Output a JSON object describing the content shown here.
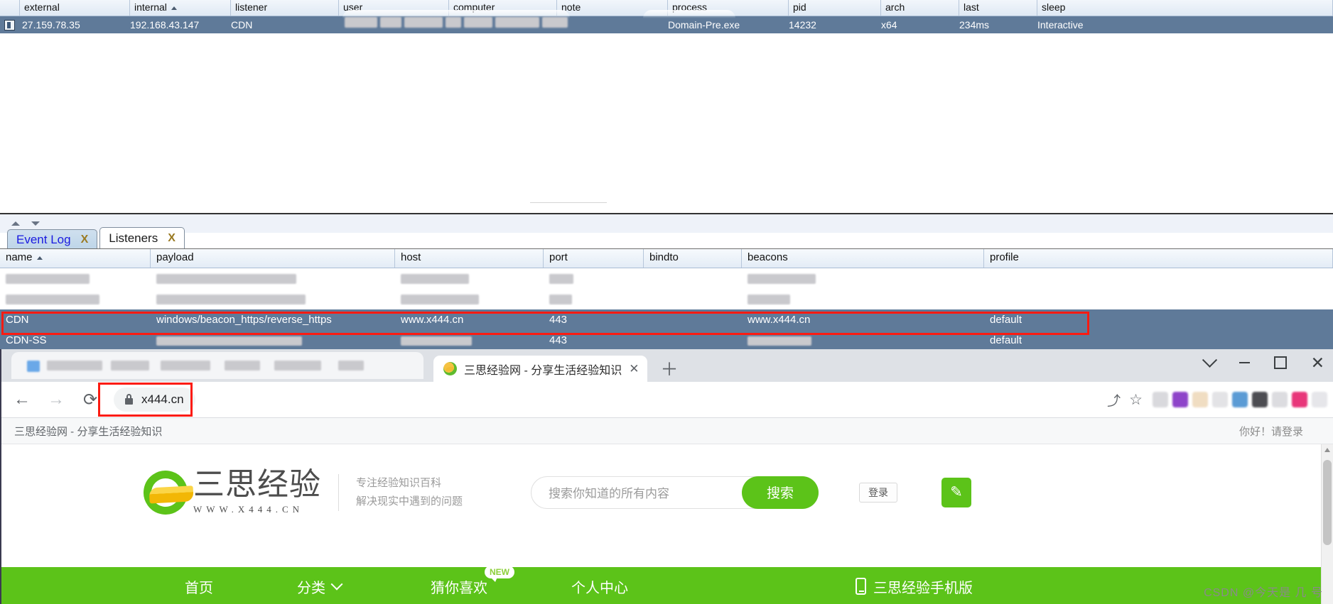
{
  "beacon_table": {
    "columns": [
      "external",
      "internal",
      "listener",
      "user",
      "computer",
      "note",
      "process",
      "pid",
      "arch",
      "last",
      "sleep"
    ],
    "sorted_column": "internal",
    "rows": [
      {
        "external": "27.159.78.35",
        "internal": "192.168.43.147",
        "listener": "CDN",
        "user": "",
        "computer": "",
        "note": "",
        "process": "Domain-Pre.exe",
        "pid": "14232",
        "arch": "x64",
        "last": "234ms",
        "sleep": "Interactive"
      }
    ]
  },
  "tabs": [
    {
      "label": "Event Log",
      "close": "X",
      "active": false
    },
    {
      "label": "Listeners",
      "close": "X",
      "active": true
    }
  ],
  "listeners_table": {
    "columns": [
      "name",
      "payload",
      "host",
      "port",
      "bindto",
      "beacons",
      "profile"
    ],
    "sorted_column": "name",
    "selected_row": {
      "name": "CDN",
      "payload": "windows/beacon_https/reverse_https",
      "host": "www.x444.cn",
      "port": "443",
      "bindto": "",
      "beacons": "www.x444.cn",
      "profile": "default"
    }
  },
  "browser": {
    "tab_title": "三思经验网 - 分享生活经验知识",
    "tab_close": "✕",
    "new_tab": "＋",
    "back": "←",
    "forward": "→",
    "reload": "⟳",
    "url": "x444.cn",
    "share": "⤴",
    "bookmark": "☆",
    "window_controls": {
      "minimize": "—",
      "maximize": "▢",
      "close": "✕"
    },
    "bookmark_bar_item": "三思经验网 - 分享生活经验知识",
    "greeting": "你好！请登录"
  },
  "site": {
    "logo_main": "三思经验",
    "logo_sub": "WWW.X444.CN",
    "slogan_line1": "专注经验知识百科",
    "slogan_line2": "解决现实中遇到的问题",
    "search_placeholder": "搜索你知道的所有内容",
    "search_button": "搜索",
    "login_button": "登录",
    "write_icon": "✎",
    "nav": [
      {
        "label": "首页",
        "chevron": false,
        "badge": ""
      },
      {
        "label": "分类",
        "chevron": true,
        "badge": ""
      },
      {
        "label": "猜你喜欢",
        "chevron": false,
        "badge": "NEW"
      },
      {
        "label": "个人中心",
        "chevron": false,
        "badge": ""
      }
    ],
    "mobile_link": "三思经验手机版"
  },
  "watermark": "CSDN @今天是 几 号",
  "colors": {
    "brand_green": "#5cc319",
    "selection_blue": "#5f7a99",
    "highlight_red": "#fc1b12"
  }
}
